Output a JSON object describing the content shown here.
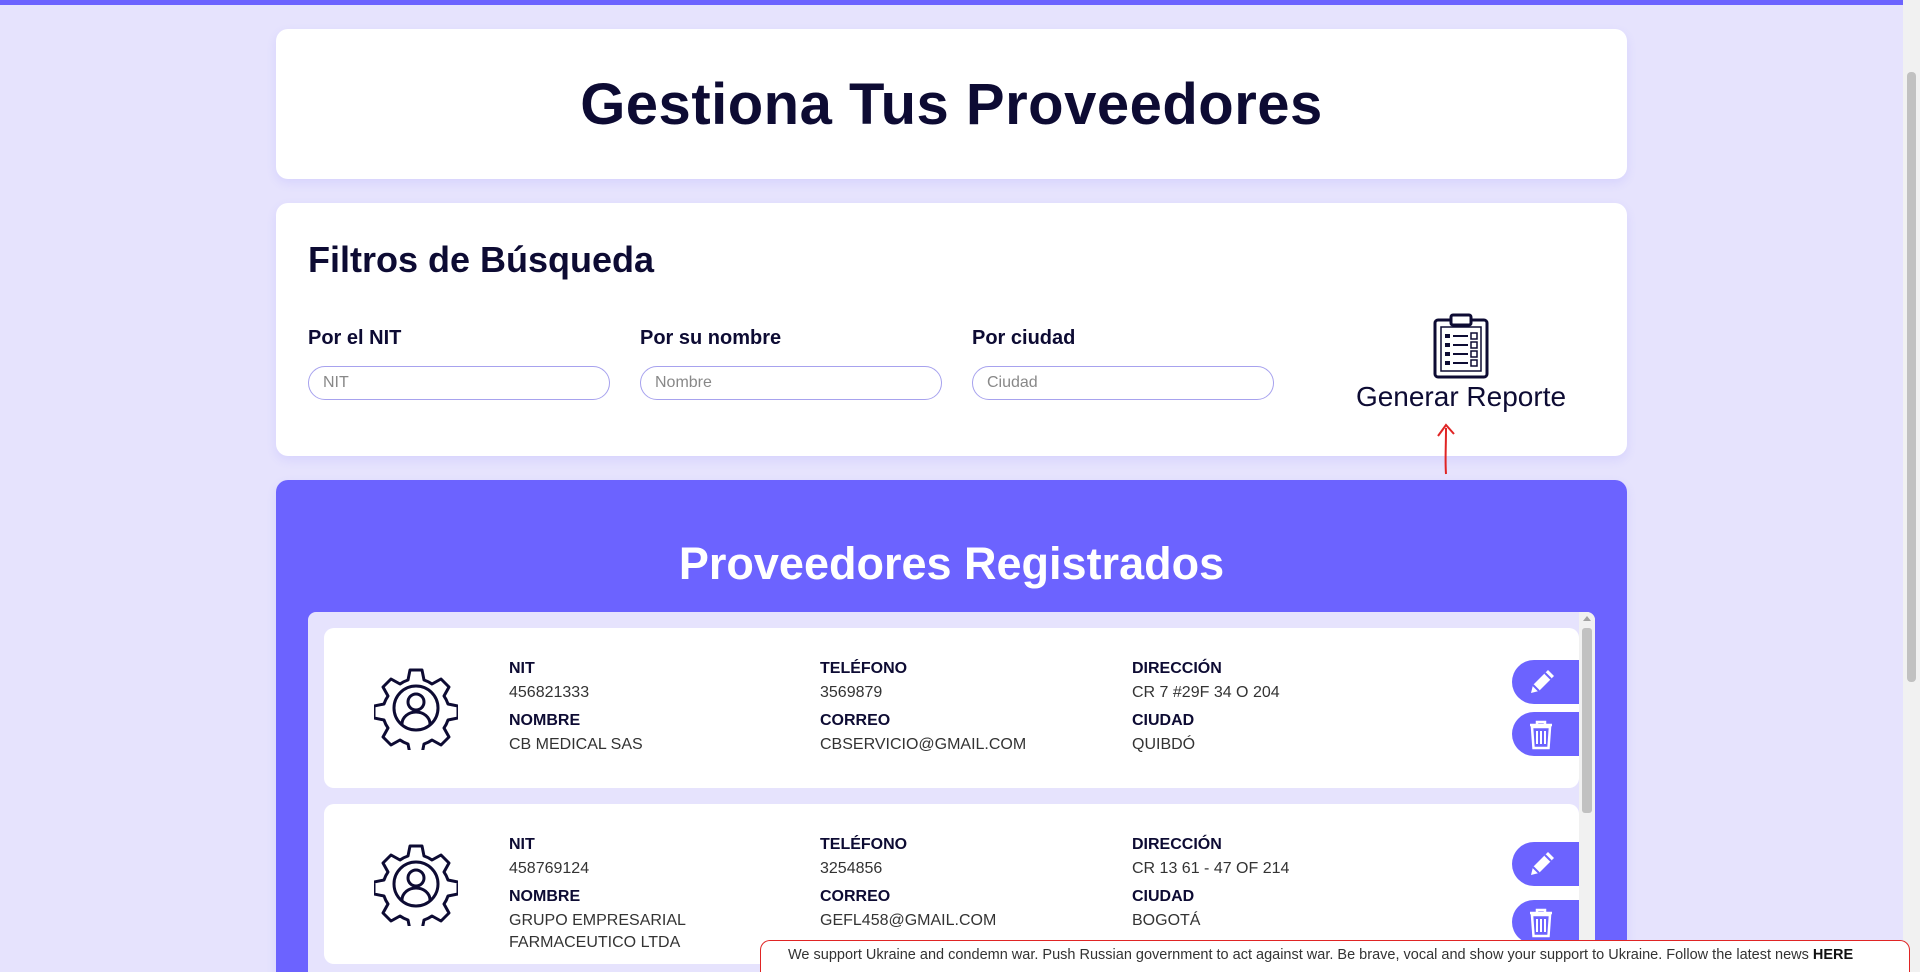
{
  "header": {
    "title": "Gestiona Tus Proveedores"
  },
  "filters": {
    "title": "Filtros de Búsqueda",
    "nit": {
      "label": "Por el NIT",
      "placeholder": "NIT"
    },
    "name": {
      "label": "Por su nombre",
      "placeholder": "Nombre"
    },
    "city": {
      "label": "Por ciudad",
      "placeholder": "Ciudad"
    },
    "report_label": "Generar Reporte",
    "report_icon": "clipboard-icon"
  },
  "list": {
    "title": "Proveedores Registrados",
    "field_labels": {
      "nit": "NIT",
      "phone": "TELÉFONO",
      "address": "DIRECCIÓN",
      "name": "NOMBRE",
      "email": "CORREO",
      "city": "CIUDAD"
    },
    "providers": [
      {
        "nit": "456821333",
        "phone": "3569879",
        "address": "CR 7 #29F 34 O 204",
        "name": "CB MEDICAL SAS",
        "email": "CBSERVICIO@GMAIL.COM",
        "city": "QUIBDÓ"
      },
      {
        "nit": "458769124",
        "phone": "3254856",
        "address": "CR 13 61 - 47 OF 214",
        "name": "GRUPO EMPRESARIAL FARMACEUTICO LTDA",
        "email": "GEFL458@GMAIL.COM",
        "city": "BOGOTÁ"
      }
    ]
  },
  "banner": {
    "text": "We support Ukraine and condemn war. Push Russian government to act against war. Be brave, vocal and show your support to Ukraine. Follow the latest news",
    "link": "HERE"
  },
  "colors": {
    "accent": "#6c63ff",
    "background": "#e6e3fd",
    "text": "#0d0b33"
  }
}
